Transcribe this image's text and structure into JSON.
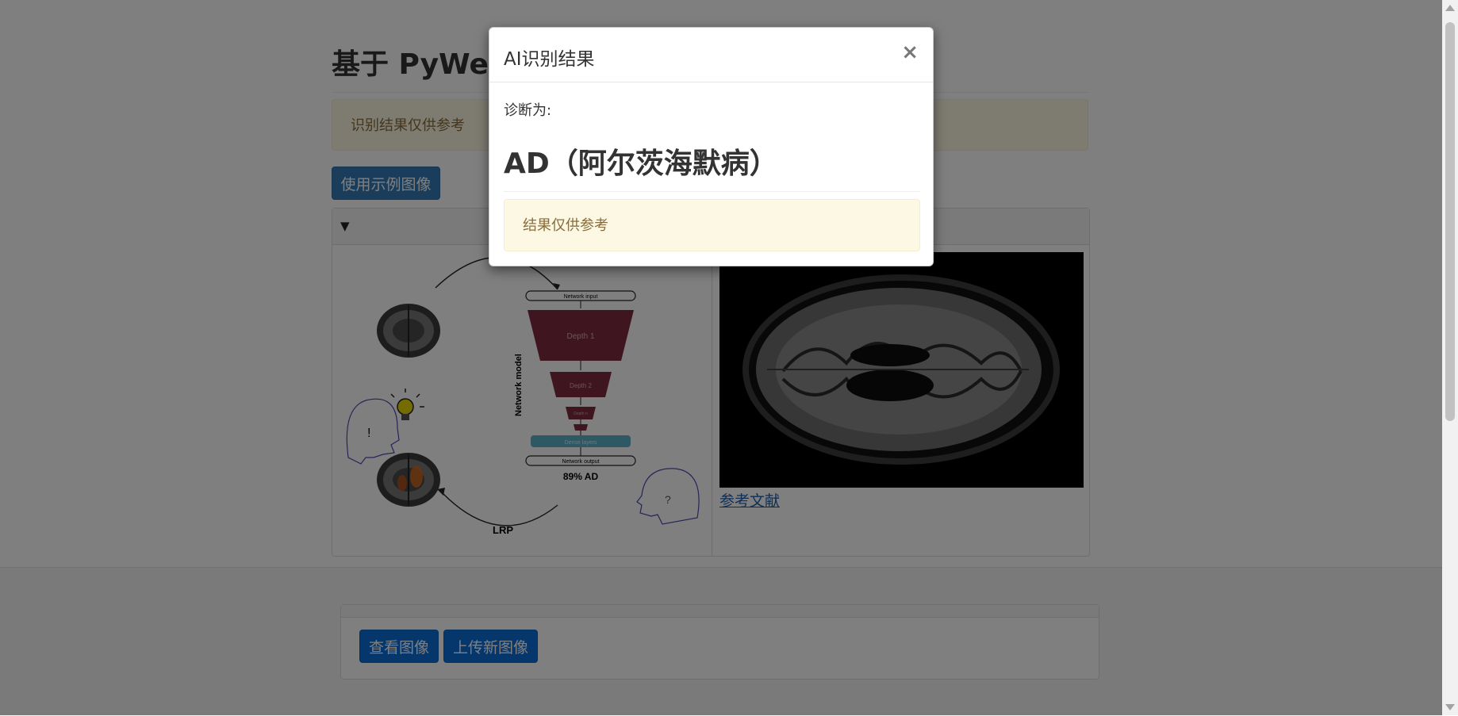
{
  "page": {
    "title": "基于 PyWebIO 的阿尔茨海默病辅助诊断系统",
    "disclaimer": "识别结果仅供参考",
    "example_button": "使用示例图像",
    "panel_toggle": "▼",
    "reference_link": "参考文献",
    "view_button": "查看图像",
    "upload_button": "上传新图像"
  },
  "figure": {
    "network_input": "Network input",
    "depth1": "Depth 1",
    "depth2": "Depth 2",
    "depth_n": "Depth n",
    "dense": "Dense layers",
    "network_output": "Network output",
    "model_label": "Network model",
    "prediction": "89% AD",
    "lrp": "LRP",
    "exclaim": "!",
    "question": "?"
  },
  "modal": {
    "title": "AI识别结果",
    "close": "×",
    "label": "诊断为:",
    "result": "AD（阿尔茨海默病）",
    "note": "结果仅供参考"
  },
  "colors": {
    "primary": "#337ab7",
    "primary_dark": "#0a6fd8",
    "warning_bg": "#fcf8e3",
    "warning_text": "#8a6d3b",
    "link": "#1a5fb4"
  }
}
